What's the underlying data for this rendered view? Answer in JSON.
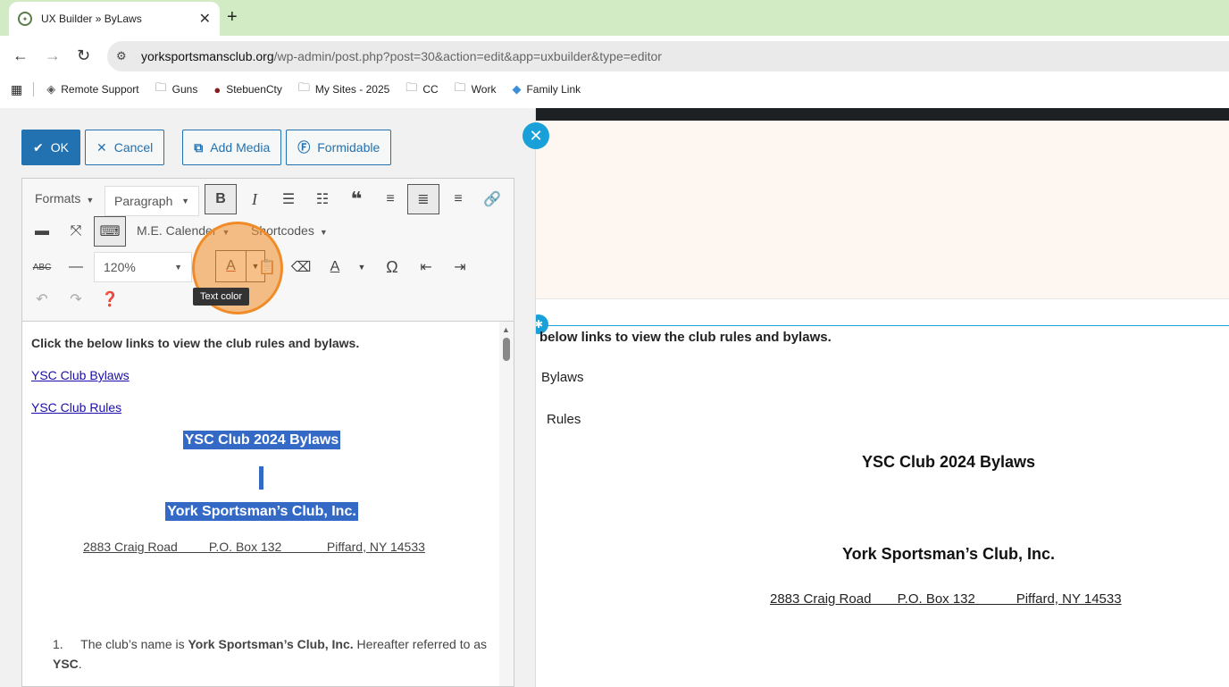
{
  "browser": {
    "tab_title": "UX Builder » ByLaws",
    "url_domain": "yorksportsmansclub.org",
    "url_path": "/wp-admin/post.php?post=30&action=edit&app=uxbuilder&type=editor",
    "bookmarks": [
      "Remote Support",
      "Guns",
      "StebuenCty",
      "My Sites - 2025",
      "CC",
      "Work",
      "Family Link"
    ]
  },
  "editor": {
    "ok_label": "OK",
    "cancel_label": "Cancel",
    "add_media_label": "Add Media",
    "formidable_label": "Formidable",
    "formats_label": "Formats",
    "paragraph_value": "Paragraph",
    "me_calendar_label": "M.E. Calender",
    "shortcodes_label": "Shortcodes",
    "font_size_value": "120%",
    "tooltip": "Text color",
    "content": {
      "intro": "Click the below links to view the club rules and bylaws.",
      "link1": "YSC Club Bylaws",
      "link2": "YSC Club Rules",
      "heading1": "YSC Club 2024 Bylaws",
      "heading2": "York Sportsman’s Club, Inc.",
      "address": "2883 Craig Road         P.O. Box 132             Piffard, NY 14533",
      "list_num": "1.",
      "list_pre": "The club’s name is ",
      "list_bold": "York Sportsman’s Club, Inc.",
      "list_mid": "  Hereafter referred to as ",
      "list_bold2": "YSC",
      "list_end": "."
    }
  },
  "preview": {
    "intro_fragment": "below links to view the club rules and bylaws.",
    "link1_fragment": "Bylaws",
    "link2_fragment": "Rules",
    "heading1": "YSC Club 2024 Bylaws",
    "heading2": "York Sportsman’s Club, Inc.",
    "address": "2883 Craig Road       P.O. Box 132           Piffard, NY 14533"
  },
  "colors": {
    "accent": "#2271b1",
    "selection": "#3469c6",
    "highlight": "#f08c28",
    "tab_bar": "#d3ebc4"
  }
}
